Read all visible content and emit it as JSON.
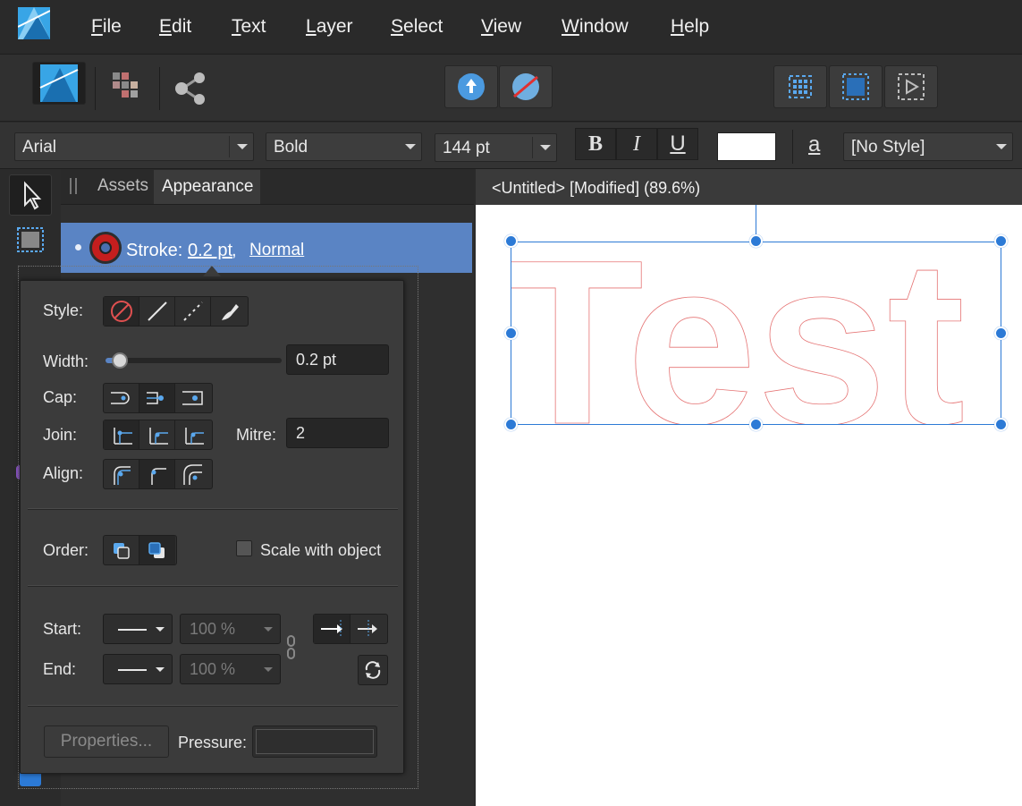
{
  "menu": {
    "items": [
      "File",
      "Edit",
      "Text",
      "Layer",
      "Select",
      "View",
      "Window",
      "Help"
    ],
    "underlines": [
      "F",
      "E",
      "T",
      "L",
      "S",
      "V",
      "W",
      "H"
    ],
    "rest": [
      "ile",
      "dit",
      "ext",
      "ayer",
      "elect",
      "iew",
      "indow",
      "elp"
    ]
  },
  "context": {
    "font": "Arial",
    "weight": "Bold",
    "size": "144 pt",
    "bold": "B",
    "italic": "I",
    "underline": "U",
    "char_style_glyph": "a",
    "paragraph_style": "[No Style]"
  },
  "panel": {
    "tabs": [
      "Assets",
      "Appearance"
    ],
    "stroke_label": "Stroke:",
    "stroke_width": "0.2 pt",
    "stroke_blend": "Normal"
  },
  "popover": {
    "style_label": "Style:",
    "width_label": "Width:",
    "width_value": "0.2 pt",
    "cap_label": "Cap:",
    "join_label": "Join:",
    "mitre_label": "Mitre:",
    "mitre_value": "2",
    "align_label": "Align:",
    "order_label": "Order:",
    "scale_label": "Scale with object",
    "start_label": "Start:",
    "end_label": "End:",
    "start_pct": "100 %",
    "end_pct": "100 %",
    "properties_label": "Properties...",
    "pressure_label": "Pressure:"
  },
  "document": {
    "title": "<Untitled> [Modified] (89.6%)",
    "text": "Test",
    "text_color": "#e57373"
  },
  "colors": {
    "accent": "#2c7ad6",
    "selection_row": "#5a84c4",
    "stroke_red": "#d0201f"
  }
}
